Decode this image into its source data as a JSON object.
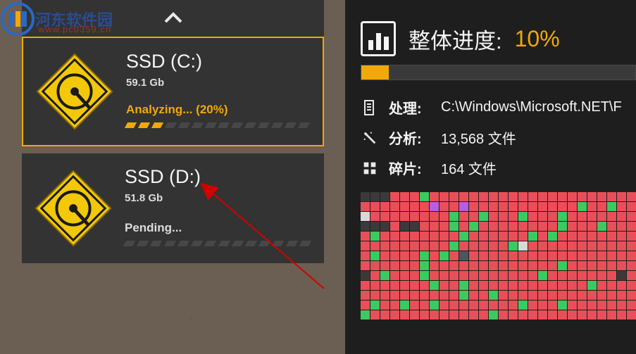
{
  "watermark": {
    "name": "河东软件园",
    "url": "www.pc0359.cn"
  },
  "drives": [
    {
      "name": "SSD (C:)",
      "size": "59.1 Gb",
      "status": "Analyzing... (20%)",
      "status_kind": "active",
      "selected": true,
      "progress_blocks": 14,
      "progress_fill": 3
    },
    {
      "name": "SSD (D:)",
      "size": "51.8 Gb",
      "status": "Pending...",
      "status_kind": "pending",
      "selected": false,
      "progress_blocks": 14,
      "progress_fill": 0
    }
  ],
  "overall": {
    "title": "整体进度:",
    "percent": "10%",
    "bar_fill_pct": 10
  },
  "stats": {
    "processing_label": "处理:",
    "processing_value": "C:\\Windows\\Microsoft.NET\\F",
    "analysis_label": "分析:",
    "analysis_value": "13,568 文件",
    "frag_label": "碎片:",
    "frag_value": "164 文件"
  },
  "blockmap_pattern": "dddrrrgrrrrrrrrrrrrrrrrrrrrr rrrrrrrprrprrrrrrrrrrrgrrgrr wrrrrrrrrgrrgrrrgrrrgrrrrrrr dddrddrrrgrgrrrrrrrrgrrrgrrr rgrrrrrrrrgrrrrrrgrgrrrrrrrr rrrrrrrrrgrrrrrgwrrrrrrrrrrr rgrrrrgrgrbrrrrrrrrrrrrrrrrr rrrrrrgrrrrrrrrrrrrrgrrrrrrr drgrrrgrrrrrrrrrrrgrrrrrrrdr rrrrrrrgrrgrrrrrrrrrrrrgrrrr rrrrrrrrrrgrrgrrrrrrrrrrrrrr rgrrgrrgrrrrrrrrgrrrgrrrrrrr grrrrrrrrrrrrgrrrrrrrrrrrrrr"
}
